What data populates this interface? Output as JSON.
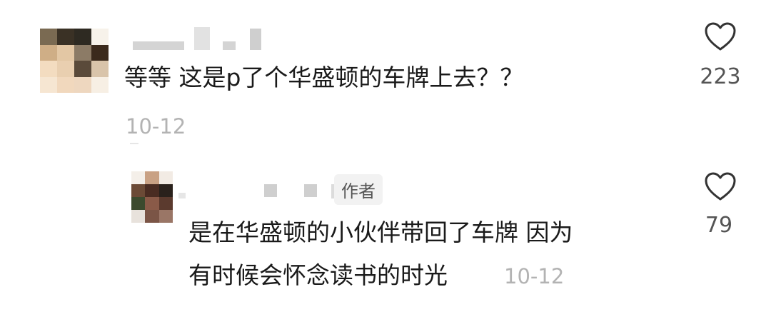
{
  "comment": {
    "text": "等等 这是p了个华盛顿的车牌上去？？",
    "date": "10-12",
    "likes": "223",
    "avatar_colors": [
      "#7a6a52",
      "#3a3125",
      "#2e2a22",
      "#f7f2ea",
      "#cfae86",
      "#e3c7a4",
      "#8c7b66",
      "#3b2a1c",
      "#f3dcc0",
      "#e9cfb0",
      "#5a4a3a",
      "#d9c4aa",
      "#f6e6d2",
      "#f1d8bd",
      "#eed7bf",
      "#f7efe4"
    ]
  },
  "reply": {
    "author_tag": "作者",
    "text_line1": "是在华盛顿的小伙伴带回了车牌 因为",
    "text_line2": "有时候会怀念读书的时光",
    "date": "10-12",
    "likes": "79",
    "avatar_colors": [
      "#f4efe9",
      "#c9a184",
      "#f2ebe4",
      "#6b4a36",
      "#4a2c22",
      "#2a211c",
      "#3c4a2e",
      "#8a5a48",
      "#5b3a2e",
      "#e8e2dc",
      "#7b5546",
      "#9a7666"
    ]
  },
  "icons": {
    "like": "heart-outline-icon"
  }
}
